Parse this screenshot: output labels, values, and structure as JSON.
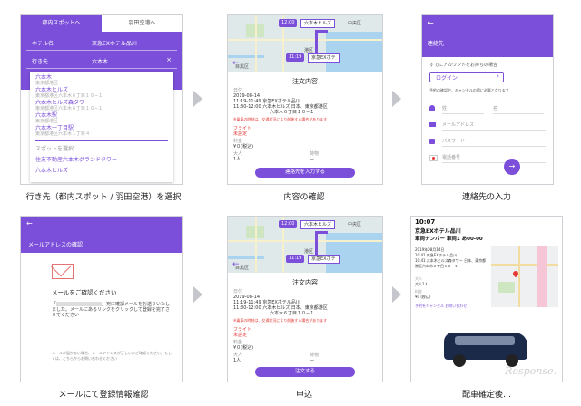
{
  "captions": {
    "p1": "行き先（都内スポット / 羽田空港）を選択",
    "p2": "内容の確認",
    "p3": "連絡先の入力",
    "p4": "メールにて登録情報確認",
    "p5": "申込",
    "p6": "配車確定後…"
  },
  "panel1": {
    "tab_active": "都内スポットへ",
    "tab_other": "羽田空港へ",
    "hotel_label": "ホテル名",
    "hotel_value": "京急EXホテル品川",
    "dest_label": "行き先",
    "dest_value": "六本木",
    "clear_icon": "×",
    "suggestions": [
      {
        "main": "六本木",
        "sub": "東京都港区"
      },
      {
        "main": "六本木ヒルズ",
        "sub": "東京都港区六本木６丁目１０−１"
      },
      {
        "main": "六本木ヒルズ森タワー",
        "sub": "東京都港区六本木６丁目１０−１"
      },
      {
        "main": "六本木駅",
        "sub": "東京都港区"
      },
      {
        "main": "六本木一丁目駅",
        "sub": "東京都港区六本木１丁目４"
      }
    ],
    "spot_select": "スポットを選択",
    "spots": [
      "住友不動産六本木グランドタワー",
      "六本木ヒルズ"
    ]
  },
  "order": {
    "map_time_1": "12:00",
    "map_dest": "六本木ヒルズ",
    "map_time_2": "11:19",
    "map_origin": "京急EXホテ",
    "map_label_chuo": "中央区",
    "map_label_meguro": "目黒区",
    "map_label_minato": "港区",
    "title": "注文内容",
    "date_label": "日付",
    "date": "2019-08-14",
    "line1": "11:19-11:49 京急EXホテル品川",
    "line2": "11:30-12:00 六本木ヒルズ 日本、東京都港区",
    "line3": "六本木６丁目１０−１",
    "note": "※乗車の時刻は、交通状況により前後する場合があります",
    "flight_label": "フライト",
    "flight_value": "未設定",
    "fare_label": "料金",
    "fare_value": "¥０(税込)",
    "people_label": "大人",
    "people_value": "1人",
    "luggage_label": "荷物",
    "luggage_value": "—",
    "button_contact": "連絡先を入力する",
    "button_apply": "注文する"
  },
  "panel3": {
    "header": "連絡先",
    "text1": "すでにアカウントをお持ちの場合",
    "login": "ログイン",
    "text2": "予約の確認や、キャンセルの際に必要となります",
    "ph_last": "姓",
    "ph_first": "名",
    "ph_email": "メールアドレス",
    "ph_password": "パスワード",
    "ph_phone": "電話番号"
  },
  "panel4": {
    "header": "メールアドレスの確認",
    "title": "メールをご確認ください",
    "body1": "「",
    "body2": "」宛に確認メールをお送りいたしました。メールにあるリンクをクリックして登録を完了させてください",
    "footer": "メールが届かない場合、メールアドレスが正しいかご確認ください。もしくは、こちらからお問い合わせください",
    "footer_link": "こちら"
  },
  "panel6": {
    "time": "10:07",
    "hotel": "京急EXホテル品川",
    "plate": "車両ナンバー 車両1 あ00-00",
    "detail1": "2019年08月14日",
    "detail2": "10:41 京急EXホテル品川",
    "detail3": "10:41 六本木ヒルズ森タワー 日本、東京都港区六本木６丁目１０−１",
    "people_label": "大人",
    "people_value": "大人1人",
    "fare_label": "料金",
    "fare_value": "¥0 (税込)",
    "links": "予約をキャンセル  お問い合わせ",
    "watermark": "Response."
  }
}
